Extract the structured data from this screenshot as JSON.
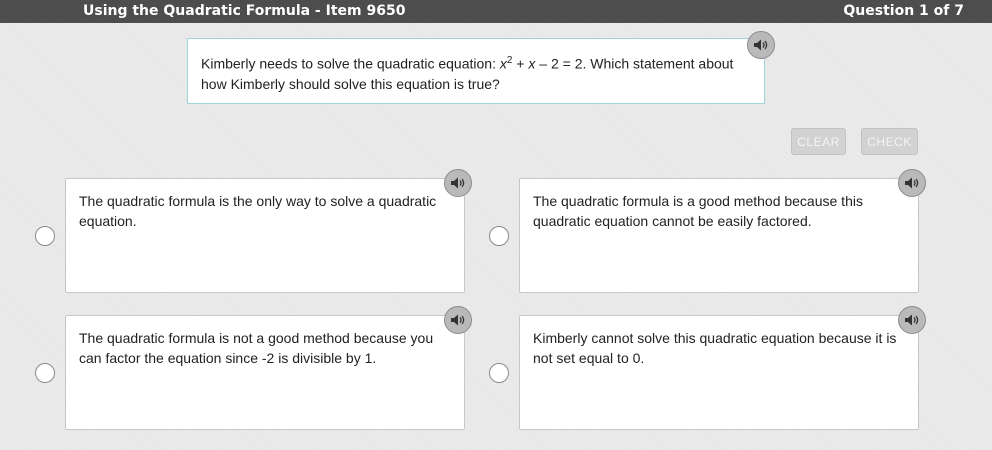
{
  "header": {
    "title": "Using the Quadratic Formula - Item 9650",
    "question_counter": "Question 1 of 7"
  },
  "prompt": {
    "text_before": "Kimberly needs to solve the quadratic equation: ",
    "var_x": "x",
    "exponent": "2",
    "plus": " + ",
    "var_x2": "x",
    "text_after": " – 2 = 2. Which statement about how Kimberly should solve this equation is true?"
  },
  "buttons": {
    "clear_label": "CLEAR",
    "check_label": "CHECK"
  },
  "options": [
    {
      "text": "The quadratic formula is the only way to solve a quadratic equation."
    },
    {
      "text": "The quadratic formula is a good method because this quadratic equation cannot be easily factored."
    },
    {
      "text": "The quadratic formula is not a good method because you can factor the equation since -2 is divisible by 1."
    },
    {
      "text": "Kimberly cannot solve this quadratic equation because it is not set equal to 0."
    }
  ],
  "colors": {
    "header_bg": "#4d4d4d",
    "prompt_border": "#9fd4dd",
    "audio_button": "#b9b9b9",
    "disabled_button": "#d2d2d2"
  },
  "icons": {
    "audio": "speaker-icon"
  }
}
